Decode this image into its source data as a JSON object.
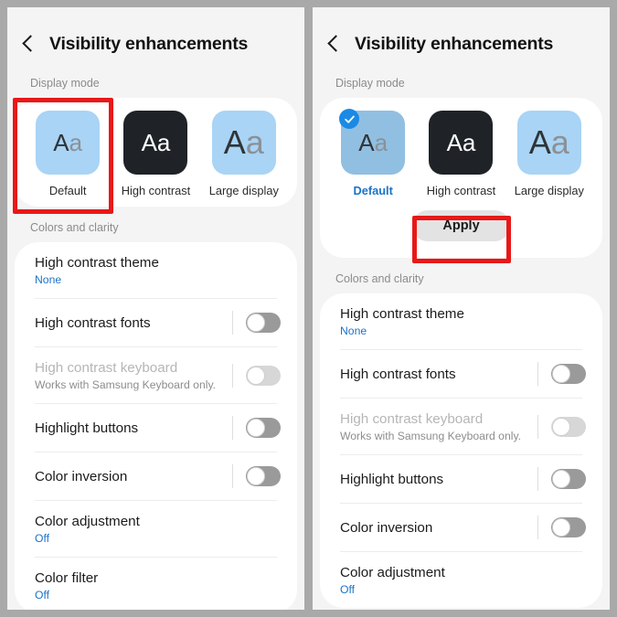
{
  "theme": {
    "accent_blue": "#1a73c8",
    "badge_blue": "#1a8ae5",
    "annotation_red": "#e81818",
    "tile_blue": "#a9d4f5",
    "tile_blue_selected": "#91bfe2",
    "tile_dark": "#1f2328",
    "page_background": "#f4f4f4",
    "frame_gray": "#a9a9a9"
  },
  "header": {
    "back_icon": "chevron-left-icon",
    "title": "Visibility enhancements"
  },
  "display_mode": {
    "section_label": "Display mode",
    "tiles": [
      {
        "label": "Default",
        "sample": "Aa",
        "style": "light-blue"
      },
      {
        "label": "High contrast",
        "sample": "Aa",
        "style": "dark"
      },
      {
        "label": "Large display",
        "sample": "Aa",
        "style": "light-blue-large"
      }
    ],
    "apply_label": "Apply"
  },
  "colors_and_clarity": {
    "section_label": "Colors and clarity",
    "items": [
      {
        "title": "High contrast theme",
        "value": "None",
        "control": "value"
      },
      {
        "title": "High contrast fonts",
        "control": "toggle",
        "toggle_state": "off"
      },
      {
        "title": "High contrast keyboard",
        "value": "Works with Samsung Keyboard only.",
        "control": "toggle",
        "toggle_state": "off",
        "disabled": true
      },
      {
        "title": "Highlight buttons",
        "control": "toggle",
        "toggle_state": "off"
      },
      {
        "title": "Color inversion",
        "control": "toggle",
        "toggle_state": "off"
      },
      {
        "title": "Color adjustment",
        "value": "Off",
        "control": "value"
      },
      {
        "title": "Color filter",
        "value": "Off",
        "control": "value"
      }
    ]
  },
  "left_panel": {
    "selected_mode_index": null,
    "annotation": "highlight-default-tile"
  },
  "right_panel": {
    "selected_mode_index": 0,
    "selected_mode_label": "Default",
    "annotation": "highlight-apply-button"
  }
}
